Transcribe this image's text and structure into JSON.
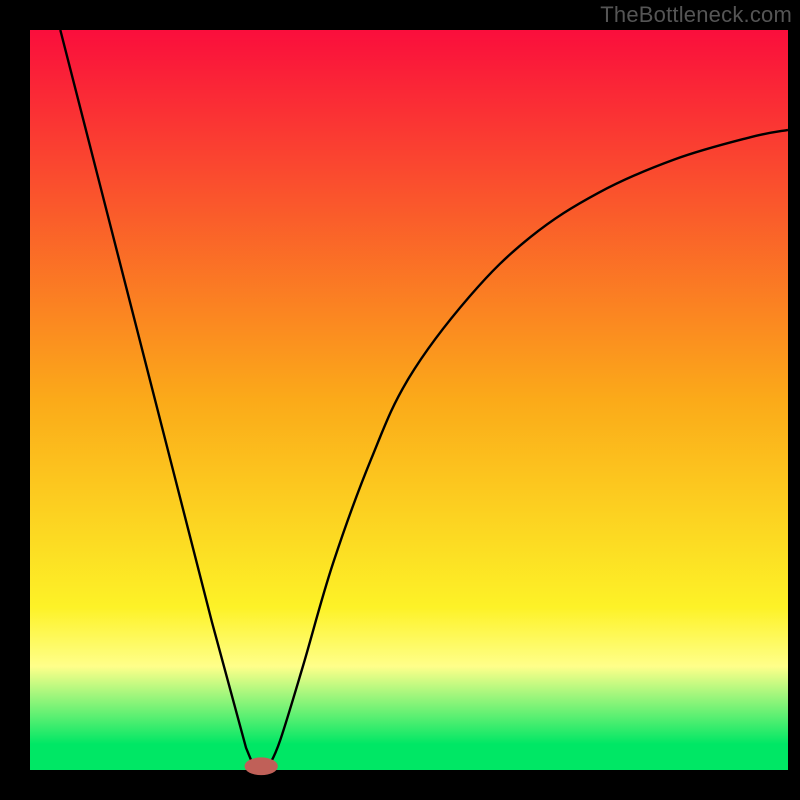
{
  "watermark": "TheBottleneck.com",
  "chart_data": {
    "type": "line",
    "title": "",
    "xlabel": "",
    "ylabel": "",
    "xlim": [
      0,
      100
    ],
    "ylim": [
      0,
      100
    ],
    "grid": false,
    "legend": false,
    "background_gradient": {
      "stops": [
        {
          "pos": 0.0,
          "color": "#fa0e3c"
        },
        {
          "pos": 0.5,
          "color": "#fbaa19"
        },
        {
          "pos": 0.78,
          "color": "#fdf227"
        },
        {
          "pos": 0.86,
          "color": "#ffff8a"
        },
        {
          "pos": 0.965,
          "color": "#00e765"
        },
        {
          "pos": 1.0,
          "color": "#00e765"
        }
      ]
    },
    "series": [
      {
        "name": "left-branch",
        "type": "line",
        "points": [
          {
            "x": 4,
            "y": 100
          },
          {
            "x": 9,
            "y": 80
          },
          {
            "x": 14,
            "y": 60
          },
          {
            "x": 19,
            "y": 40
          },
          {
            "x": 24,
            "y": 20
          },
          {
            "x": 28.5,
            "y": 3
          },
          {
            "x": 29.5,
            "y": 0.5
          }
        ]
      },
      {
        "name": "right-branch",
        "type": "line",
        "points": [
          {
            "x": 31.5,
            "y": 0.5
          },
          {
            "x": 33,
            "y": 4
          },
          {
            "x": 36,
            "y": 14
          },
          {
            "x": 40,
            "y": 28
          },
          {
            "x": 45,
            "y": 42
          },
          {
            "x": 50,
            "y": 53
          },
          {
            "x": 58,
            "y": 64
          },
          {
            "x": 66,
            "y": 72
          },
          {
            "x": 75,
            "y": 78
          },
          {
            "x": 85,
            "y": 82.5
          },
          {
            "x": 95,
            "y": 85.5
          },
          {
            "x": 100,
            "y": 86.5
          }
        ]
      }
    ],
    "marker": {
      "x": 30.5,
      "y": 0.5,
      "rx": 2.2,
      "ry": 1.2,
      "color": "#c06058"
    }
  }
}
